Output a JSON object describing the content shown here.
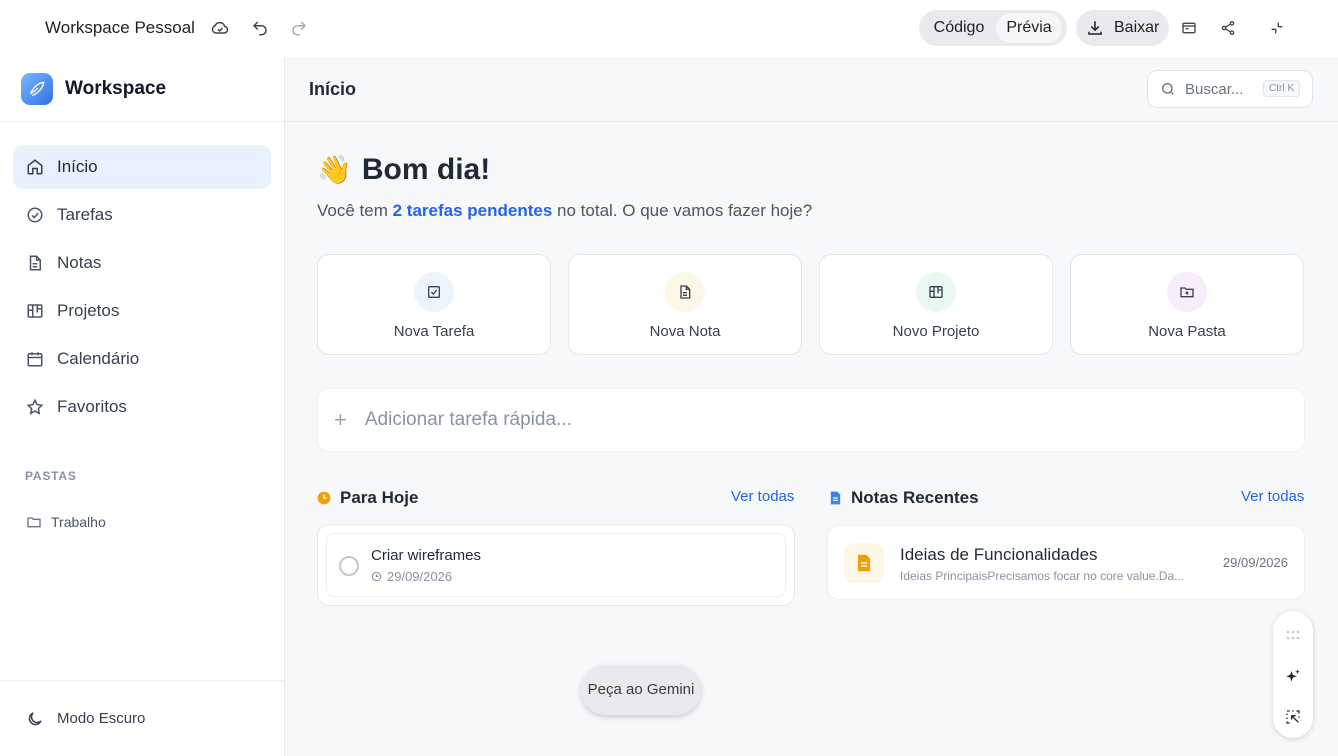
{
  "topbar": {
    "title": "Workspace Pessoal",
    "icons": [
      "cloud-icon",
      "undo-icon",
      "redo-icon",
      "download-icon",
      "terminal-icon",
      "share-icon",
      "collapse-icon"
    ],
    "code_label": "Código",
    "preview_label": "Prévia",
    "download_label": "Baixar"
  },
  "sidebar": {
    "brand": "Workspace",
    "items": [
      {
        "label": "Início",
        "icon": "home-icon",
        "active": true
      },
      {
        "label": "Tarefas",
        "icon": "check-circle-icon"
      },
      {
        "label": "Notas",
        "icon": "document-icon"
      },
      {
        "label": "Projetos",
        "icon": "board-icon"
      },
      {
        "label": "Calendário",
        "icon": "calendar-icon"
      },
      {
        "label": "Favoritos",
        "icon": "star-icon"
      }
    ],
    "folders_label": "PASTAS",
    "folders": [
      {
        "label": "Trabalho",
        "icon": "folder-icon"
      }
    ],
    "dark_mode_label": "Modo Escuro"
  },
  "main": {
    "title": "Início",
    "search_placeholder": "Buscar...",
    "search_shortcut": "Ctrl K",
    "greeting_emoji": "👋",
    "greeting": "Bom dia!",
    "subline_prefix": "Você tem",
    "subline_highlight": "2 tarefas pendentes",
    "subline_suffix": "no total. O que vamos fazer hoje?",
    "quick_actions": [
      {
        "label": "Nova Tarefa",
        "icon": "checkbox-icon",
        "bg": "#eef4fe"
      },
      {
        "label": "Nova Nota",
        "icon": "note-icon",
        "bg": "#fdf8e6"
      },
      {
        "label": "Novo Projeto",
        "icon": "board-icon",
        "bg": "#e9f8f1"
      },
      {
        "label": "Nova Pasta",
        "icon": "folder-plus-icon",
        "bg": "#f8eefb"
      }
    ],
    "quick_task_placeholder": "Adicionar tarefa rápida...",
    "today": {
      "title": "Para Hoje",
      "link": "Ver todas",
      "tasks": [
        {
          "title": "Criar wireframes",
          "date": "29/09/2026"
        }
      ]
    },
    "notes": {
      "title": "Notas Recentes",
      "link": "Ver todas",
      "items": [
        {
          "title": "Ideias de Funcionalidades",
          "preview": "Ideias PrincipaisPrecisamos focar no core value.Da...",
          "date": "29/09/2026"
        }
      ]
    }
  },
  "gemini_button": "Peça ao Gemini",
  "colors": {
    "accent": "#2563eb",
    "active_bg": "#e9f1fe",
    "orange": "#f59e0b"
  }
}
